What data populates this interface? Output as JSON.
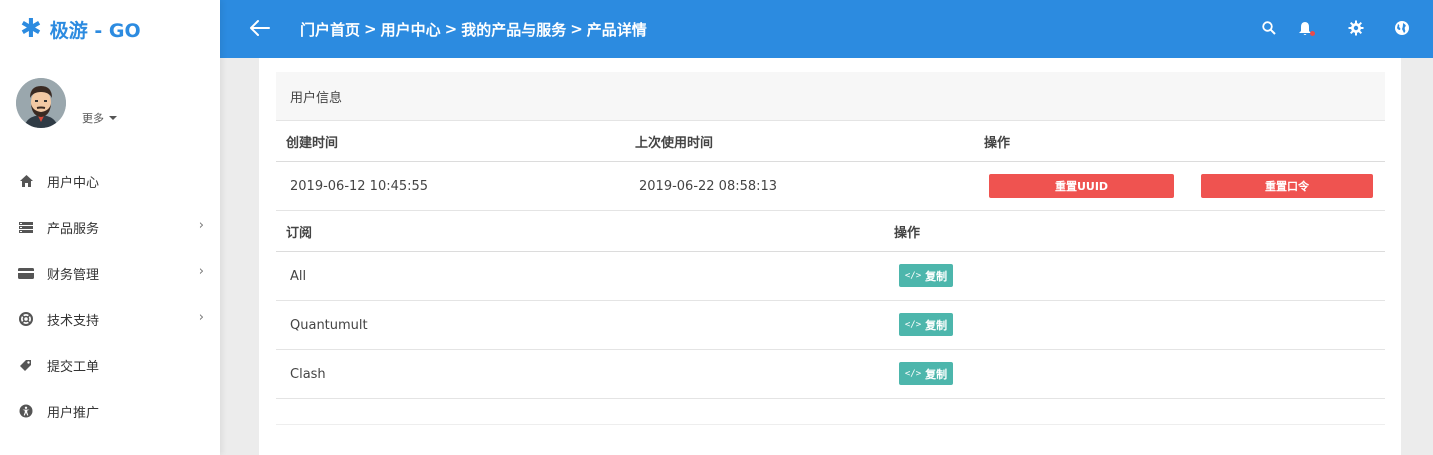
{
  "brand": {
    "icon": "asterisk-icon",
    "glyph": "✱",
    "name": "极游 - GO",
    "color": "#2c8be0"
  },
  "user": {
    "more_label": "更多"
  },
  "sidebar": {
    "items": [
      {
        "label": "用户中心",
        "icon": "home-icon",
        "has_children": false
      },
      {
        "label": "产品服务",
        "icon": "server-icon",
        "has_children": true
      },
      {
        "label": "财务管理",
        "icon": "credit-card-icon",
        "has_children": true
      },
      {
        "label": "技术支持",
        "icon": "lifebuoy-icon",
        "has_children": true
      },
      {
        "label": "提交工单",
        "icon": "tag-icon",
        "has_children": false
      },
      {
        "label": "用户推广",
        "icon": "accessibility-icon",
        "has_children": false
      }
    ],
    "chevron": "›"
  },
  "header": {
    "breadcrumb": [
      "门户首页",
      "用户中心",
      "我的产品与服务",
      "产品详情"
    ],
    "separator": ">",
    "icons": [
      "search-icon",
      "bell-icon",
      "gear-icon",
      "globe-icon"
    ],
    "bg_color": "#2c8be0"
  },
  "user_info": {
    "title": "用户信息",
    "columns": [
      "创建时间",
      "上次使用时间",
      "操作"
    ],
    "created": "2019-06-12 10:45:55",
    "last_used": "2019-06-22 08:58:13",
    "reset_uuid_label": "重置UUID",
    "reset_password_label": "重置口令"
  },
  "subscriptions": {
    "columns": [
      "订阅",
      "操作"
    ],
    "copy_code": "</>",
    "copy_label": "复制",
    "rows": [
      {
        "name": "All"
      },
      {
        "name": "Quantumult"
      },
      {
        "name": "Clash"
      }
    ]
  },
  "colors": {
    "danger": "#ef5350",
    "teal": "#4db6ac"
  }
}
